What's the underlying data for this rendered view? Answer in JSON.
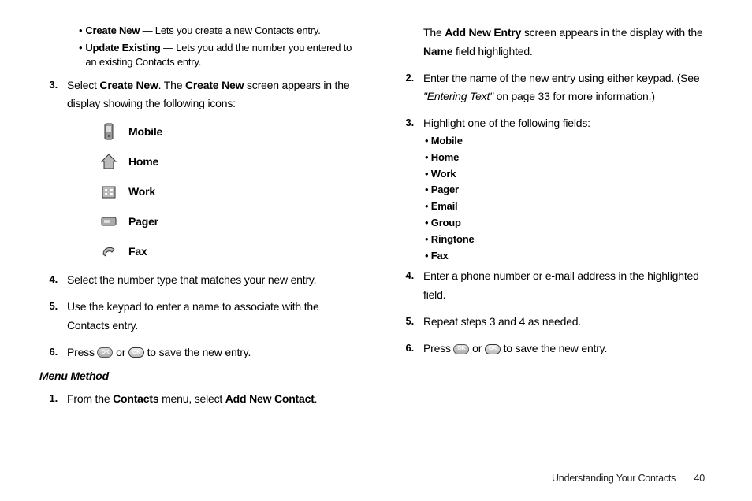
{
  "left": {
    "bullets": [
      {
        "label": "Create New",
        "desc": " — Lets you create a new Contacts entry."
      },
      {
        "label": "Update Existing",
        "desc": " — Lets you add the number you entered to an existing Contacts entry."
      }
    ],
    "step3_a": "Select ",
    "step3_b": "Create New",
    "step3_c": ". The ",
    "step3_d": "Create New",
    "step3_e": " screen appears in the display showing the following icons:",
    "icons": [
      "Mobile",
      "Home",
      "Work",
      "Pager",
      "Fax"
    ],
    "step4": " Select the number type that matches your new entry.",
    "step5": "Use the keypad to enter a name to associate with the Contacts entry.",
    "step6_a": "Press ",
    "step6_b": " or ",
    "step6_c": " to save the new entry.",
    "heading": "Menu Method",
    "mm1_a": "From the ",
    "mm1_b": "Contacts",
    "mm1_c": " menu, select ",
    "mm1_d": "Add New Contact",
    "mm1_e": "."
  },
  "right": {
    "cont_a": "The ",
    "cont_b": "Add New Entry",
    "cont_c": " screen appears in the display with the ",
    "cont_d": "Name",
    "cont_e": " field highlighted.",
    "step2_a": "Enter the name of the new entry using either keypad. (See ",
    "step2_b": "\"Entering Text\"",
    "step2_c": " on page 33 for more information.)",
    "step3": "Highlight one of the following fields:",
    "fields": [
      "Mobile",
      "Home",
      "Work",
      "Pager",
      "Email",
      "Group",
      "Ringtone",
      "Fax"
    ],
    "step4": "Enter a phone number or e-mail address in the highlighted field.",
    "step5": "Repeat steps 3 and 4 as needed.",
    "step6_a": "Press ",
    "step6_b": " or ",
    "step6_c": " to save the new entry."
  },
  "footer": {
    "section": "Understanding Your Contacts",
    "page": "40"
  },
  "nums": {
    "n1": "1.",
    "n2": "2.",
    "n3": "3.",
    "n4": "4.",
    "n5": "5.",
    "n6": "6."
  },
  "bul": "•"
}
